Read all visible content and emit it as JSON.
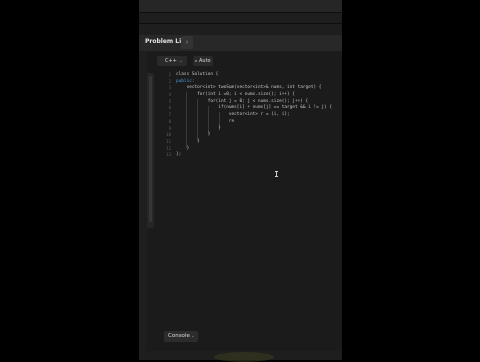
{
  "tab": {
    "label": "Problem List",
    "next_icon": "›"
  },
  "toolbar": {
    "language": "C++",
    "mode": "Auto"
  },
  "editor": {
    "line_numbers": [
      "1",
      "2",
      "3",
      "4",
      "5",
      "6",
      "7",
      "8",
      "9",
      "10",
      "11",
      "12",
      "13"
    ],
    "lines": [
      "class Solution {",
      "public:",
      "    vector<int> twoSum(vector<int>& nums, int target) {",
      "        for(int i =0; i < nums.size(); i++) {",
      "            for(int j = 0; j < nums.size(); j++) {",
      "                if(nums[i] + nums[j] == target && i != j) {",
      "                    vector<int> r = {i, i};",
      "                    re",
      "                }",
      "            }",
      "        }",
      "    }",
      "};"
    ]
  },
  "footer": {
    "console_label": "Console"
  }
}
